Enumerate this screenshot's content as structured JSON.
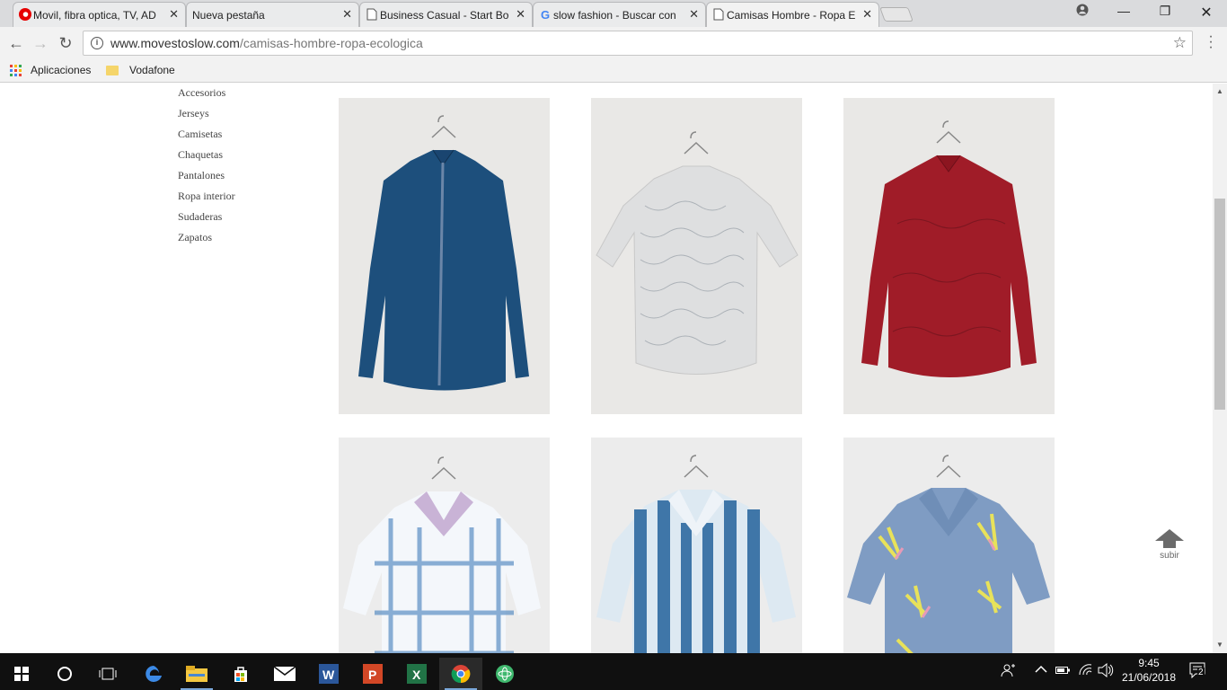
{
  "tabs": [
    {
      "title": "Movil, fibra optica, TV, AD",
      "icon": "vodafone-icon"
    },
    {
      "title": "Nueva pestaña",
      "icon": "none"
    },
    {
      "title": "Business Casual - Start Bo",
      "icon": "page-icon"
    },
    {
      "title": "slow fashion - Buscar con",
      "icon": "google-icon"
    },
    {
      "title": "Camisas Hombre - Ropa E",
      "icon": "page-icon"
    }
  ],
  "address": {
    "domain": "www.movestoslow.com",
    "path": "/camisas-hombre-ropa-ecologica"
  },
  "bookmarks": {
    "apps": "Aplicaciones",
    "vodafone": "Vodafone"
  },
  "categories": [
    "Accesorios",
    "Jerseys",
    "Camisetas",
    "Chaquetas",
    "Pantalones",
    "Ropa interior",
    "Sudaderas",
    "Zapatos"
  ],
  "products": [
    {
      "name": "navy-shirt",
      "base": "#1d4f7c"
    },
    {
      "name": "white-print-shirt",
      "base": "#dedfe0"
    },
    {
      "name": "red-shirt",
      "base": "#a01c28"
    },
    {
      "name": "tie-dye-check-shirt",
      "base": "#dbe6f0"
    },
    {
      "name": "blue-stripe-shirt",
      "base": "#3f76a8"
    },
    {
      "name": "floral-blue-shirt",
      "base": "#7f9cc3"
    }
  ],
  "back_to_top": "subir",
  "taskbar": {
    "time": "9:45",
    "date": "21/06/2018",
    "notifications": "2"
  }
}
